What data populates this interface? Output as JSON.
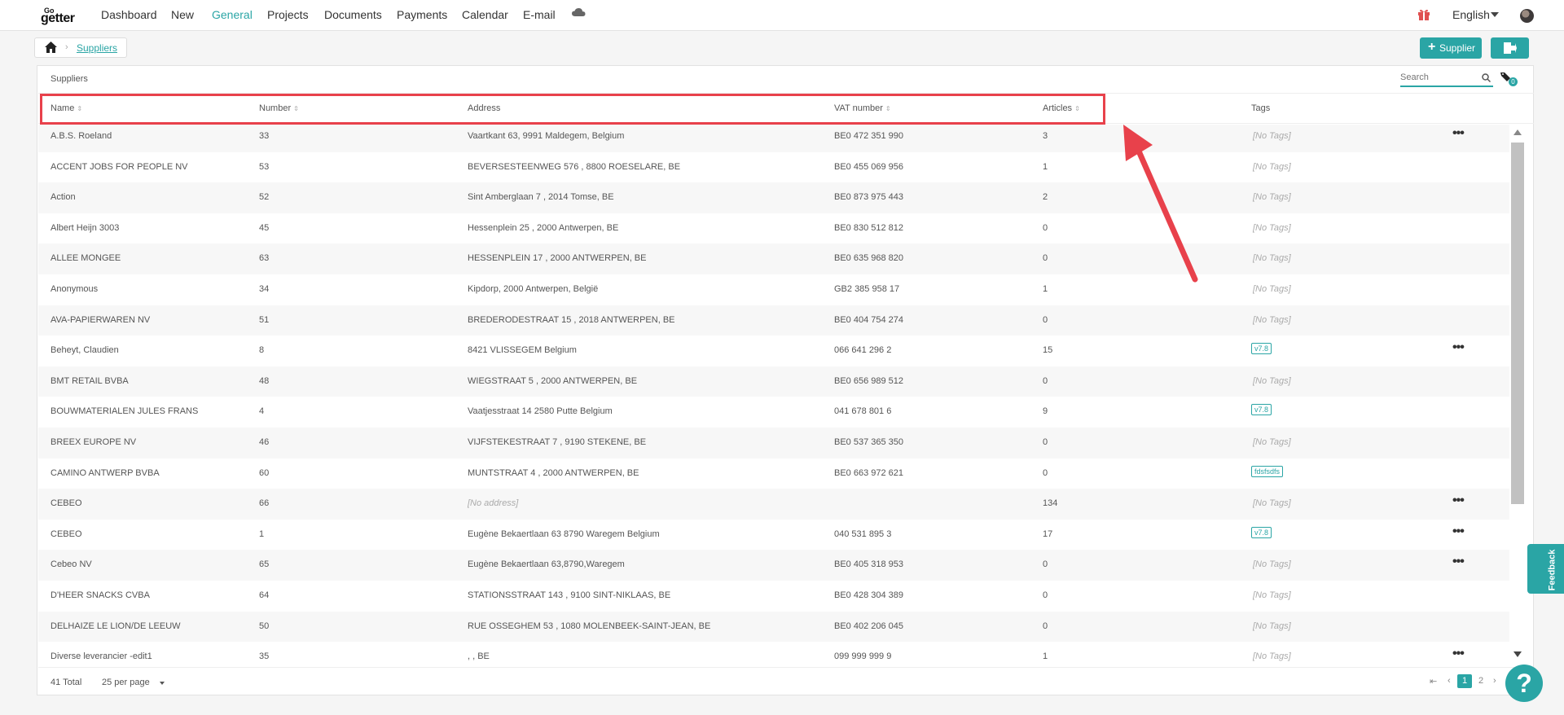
{
  "nav": {
    "logo_top": "Go",
    "logo_bottom": "getter",
    "items": [
      "Dashboard",
      "New",
      "General",
      "Projects",
      "Documents",
      "Payments",
      "Calendar",
      "E-mail"
    ],
    "active": "General",
    "language": "English"
  },
  "breadcrumb": {
    "current": "Suppliers"
  },
  "actions": {
    "add_supplier": "Supplier"
  },
  "panel": {
    "title": "Suppliers",
    "search_placeholder": "Search",
    "tag_count": "0"
  },
  "columns": {
    "name": "Name",
    "number": "Number",
    "address": "Address",
    "vat": "VAT number",
    "articles": "Articles",
    "tags": "Tags"
  },
  "rows": [
    {
      "name": "A.B.S. Roeland",
      "number": "33",
      "address": "Vaartkant 63, 9991 Maldegem, Belgium",
      "vat": "BE0 472 351 990",
      "articles": "3",
      "tag": "[No Tags]",
      "menu": true
    },
    {
      "name": "ACCENT JOBS FOR PEOPLE NV",
      "number": "53",
      "address": "BEVERSESTEENWEG 576 , 8800 ROESELARE, BE",
      "vat": "BE0 455 069 956",
      "articles": "1",
      "tag": "[No Tags]",
      "menu": false
    },
    {
      "name": "Action",
      "number": "52",
      "address": "Sint Amberglaan 7 , 2014 Tomse, BE",
      "vat": "BE0 873 975 443",
      "articles": "2",
      "tag": "[No Tags]",
      "menu": false
    },
    {
      "name": "Albert Heijn 3003",
      "number": "45",
      "address": "Hessenplein 25 , 2000 Antwerpen, BE",
      "vat": "BE0 830 512 812",
      "articles": "0",
      "tag": "[No Tags]",
      "menu": false
    },
    {
      "name": "ALLEE MONGEE",
      "number": "63",
      "address": "HESSENPLEIN 17 , 2000 ANTWERPEN, BE",
      "vat": "BE0 635 968 820",
      "articles": "0",
      "tag": "[No Tags]",
      "menu": false
    },
    {
      "name": "Anonymous",
      "number": "34",
      "address": "Kipdorp, 2000 Antwerpen, België",
      "vat": "GB2 385 958 17",
      "articles": "1",
      "tag": "[No Tags]",
      "menu": false
    },
    {
      "name": "AVA-PAPIERWAREN NV",
      "number": "51",
      "address": "BREDERODESTRAAT 15 , 2018 ANTWERPEN, BE",
      "vat": "BE0 404 754 274",
      "articles": "0",
      "tag": "[No Tags]",
      "menu": false
    },
    {
      "name": "Beheyt, Claudien",
      "number": "8",
      "address": "8421 VLISSEGEM Belgium",
      "vat": "066 641 296 2",
      "articles": "15",
      "tag": "v7.8",
      "menu": true
    },
    {
      "name": "BMT RETAIL BVBA",
      "number": "48",
      "address": "WIEGSTRAAT 5 , 2000 ANTWERPEN, BE",
      "vat": "BE0 656 989 512",
      "articles": "0",
      "tag": "[No Tags]",
      "menu": false
    },
    {
      "name": "BOUWMATERIALEN JULES FRANS",
      "number": "4",
      "address": "Vaatjesstraat 14 2580 Putte Belgium",
      "vat": "041 678 801 6",
      "articles": "9",
      "tag": "v7.8",
      "menu": false
    },
    {
      "name": "BREEX EUROPE NV",
      "number": "46",
      "address": "VIJFSTEKESTRAAT 7 , 9190 STEKENE, BE",
      "vat": "BE0 537 365 350",
      "articles": "0",
      "tag": "[No Tags]",
      "menu": false
    },
    {
      "name": "CAMINO ANTWERP BVBA",
      "number": "60",
      "address": "MUNTSTRAAT 4 , 2000 ANTWERPEN, BE",
      "vat": "BE0 663 972 621",
      "articles": "0",
      "tag": "fdsfsdfs",
      "menu": false
    },
    {
      "name": "CEBEO",
      "number": "66",
      "address": "[No address]",
      "vat": "",
      "articles": "134",
      "tag": "[No Tags]",
      "menu": true
    },
    {
      "name": "CEBEO",
      "number": "1",
      "address": "Eugène Bekaertlaan 63 8790 Waregem Belgium",
      "vat": "040 531 895 3",
      "articles": "17",
      "tag": "v7.8",
      "menu": true
    },
    {
      "name": "Cebeo NV",
      "number": "65",
      "address": "Eugène Bekaertlaan 63,8790,Waregem",
      "vat": "BE0 405 318 953",
      "articles": "0",
      "tag": "[No Tags]",
      "menu": true
    },
    {
      "name": "D'HEER SNACKS CVBA",
      "number": "64",
      "address": "STATIONSSTRAAT 143 , 9100 SINT-NIKLAAS, BE",
      "vat": "BE0 428 304 389",
      "articles": "0",
      "tag": "[No Tags]",
      "menu": false
    },
    {
      "name": "DELHAIZE LE LION/DE LEEUW",
      "number": "50",
      "address": "RUE OSSEGHEM 53 , 1080 MOLENBEEK-SAINT-JEAN, BE",
      "vat": "BE0 402 206 045",
      "articles": "0",
      "tag": "[No Tags]",
      "menu": false
    },
    {
      "name": "Diverse leverancier -edit1",
      "number": "35",
      "address": ", , BE",
      "vat": "099 999 999 9",
      "articles": "1",
      "tag": "[No Tags]",
      "menu": true
    }
  ],
  "footer": {
    "total": "41 Total",
    "per_page": "25 per page",
    "current_page": "1",
    "page2": "2"
  },
  "feedback": "Feedback",
  "help": "?",
  "colors": {
    "accent": "#2aa5a5",
    "highlight": "#e8414b"
  }
}
